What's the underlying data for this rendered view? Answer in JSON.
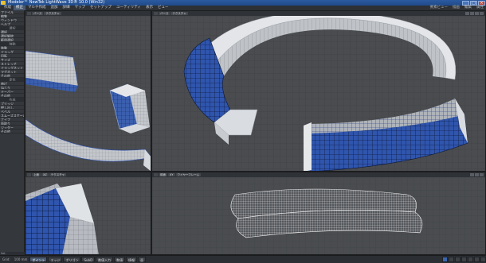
{
  "window": {
    "title": "Modeler™ NewTek LightWave 3D® 10.0 (Win32)",
    "buttons": [
      "_",
      "□",
      "×"
    ]
  },
  "menubar": {
    "tabs": [
      "作成",
      "修正",
      "マルチ作成",
      "追加",
      "詳細",
      "マップ",
      "セットアップ",
      "ユーティリティ",
      "表示",
      "ビュー"
    ],
    "active_index": 1,
    "right_items": [
      "要素ビュー",
      "描画",
      "編集",
      "属性"
    ]
  },
  "sidebar": {
    "items": [
      {
        "label": "ファイル",
        "type": "item"
      },
      {
        "label": "編集",
        "type": "item"
      },
      {
        "label": "ウィンドウ",
        "type": "item"
      },
      {
        "label": "ヘルプ",
        "type": "item"
      },
      {
        "label": "選択",
        "type": "header"
      },
      {
        "label": "選択",
        "type": "item"
      },
      {
        "label": "選択解除",
        "type": "item"
      },
      {
        "label": "範囲選択",
        "type": "item"
      },
      {
        "label": "移動",
        "type": "header"
      },
      {
        "label": "移動",
        "type": "item"
      },
      {
        "label": "ドラッグ",
        "type": "item"
      },
      {
        "label": "回転",
        "type": "item"
      },
      {
        "label": "サイズ",
        "type": "item"
      },
      {
        "label": "ストレッチ",
        "type": "item"
      },
      {
        "label": "ドラッグネット",
        "type": "item"
      },
      {
        "label": "マグネット",
        "type": "item"
      },
      {
        "label": "その他",
        "type": "item"
      },
      {
        "label": "変形",
        "type": "header"
      },
      {
        "label": "曲げ",
        "type": "item"
      },
      {
        "label": "ねじり",
        "type": "item"
      },
      {
        "label": "テーパー",
        "type": "item"
      },
      {
        "label": "その他",
        "type": "item"
      },
      {
        "label": "作成",
        "type": "header"
      },
      {
        "label": "ブリッジ",
        "type": "item"
      },
      {
        "label": "押し出し",
        "type": "item"
      },
      {
        "label": "ベベル",
        "type": "item"
      },
      {
        "label": "スムーズスケール",
        "type": "item"
      },
      {
        "label": "ナイフ",
        "type": "item"
      },
      {
        "label": "面取り",
        "type": "item"
      },
      {
        "label": "ジッター",
        "type": "item"
      },
      {
        "label": "その他",
        "type": "item"
      }
    ],
    "status": "Sel:"
  },
  "viewports": {
    "top_left": {
      "view": "バース",
      "mode": "テクスチャ",
      "shading": "ワイヤー"
    },
    "top_right": {
      "view": "バース",
      "mode": "テクスチャ",
      "shading": "ワイヤー"
    },
    "bottom_left": {
      "view": "上面",
      "axis": "XZ",
      "shading": "テクスチャ"
    },
    "bottom_right": {
      "view": "前面",
      "axis": "XY",
      "shading": "ワイヤーフレーム"
    }
  },
  "bottombar": {
    "buttons": [
      "ポイント",
      "エッジ",
      "ポリゴン",
      "SubD",
      "数値入力",
      "数値",
      "情報",
      "面"
    ],
    "active_index": 0,
    "left_label": "Grid:",
    "grid_value": "100 mm",
    "colors": {
      "accent": "#3a66b0",
      "mesh_blue": "#2a4fb8",
      "mesh_grey": "#b9bdc3"
    }
  }
}
